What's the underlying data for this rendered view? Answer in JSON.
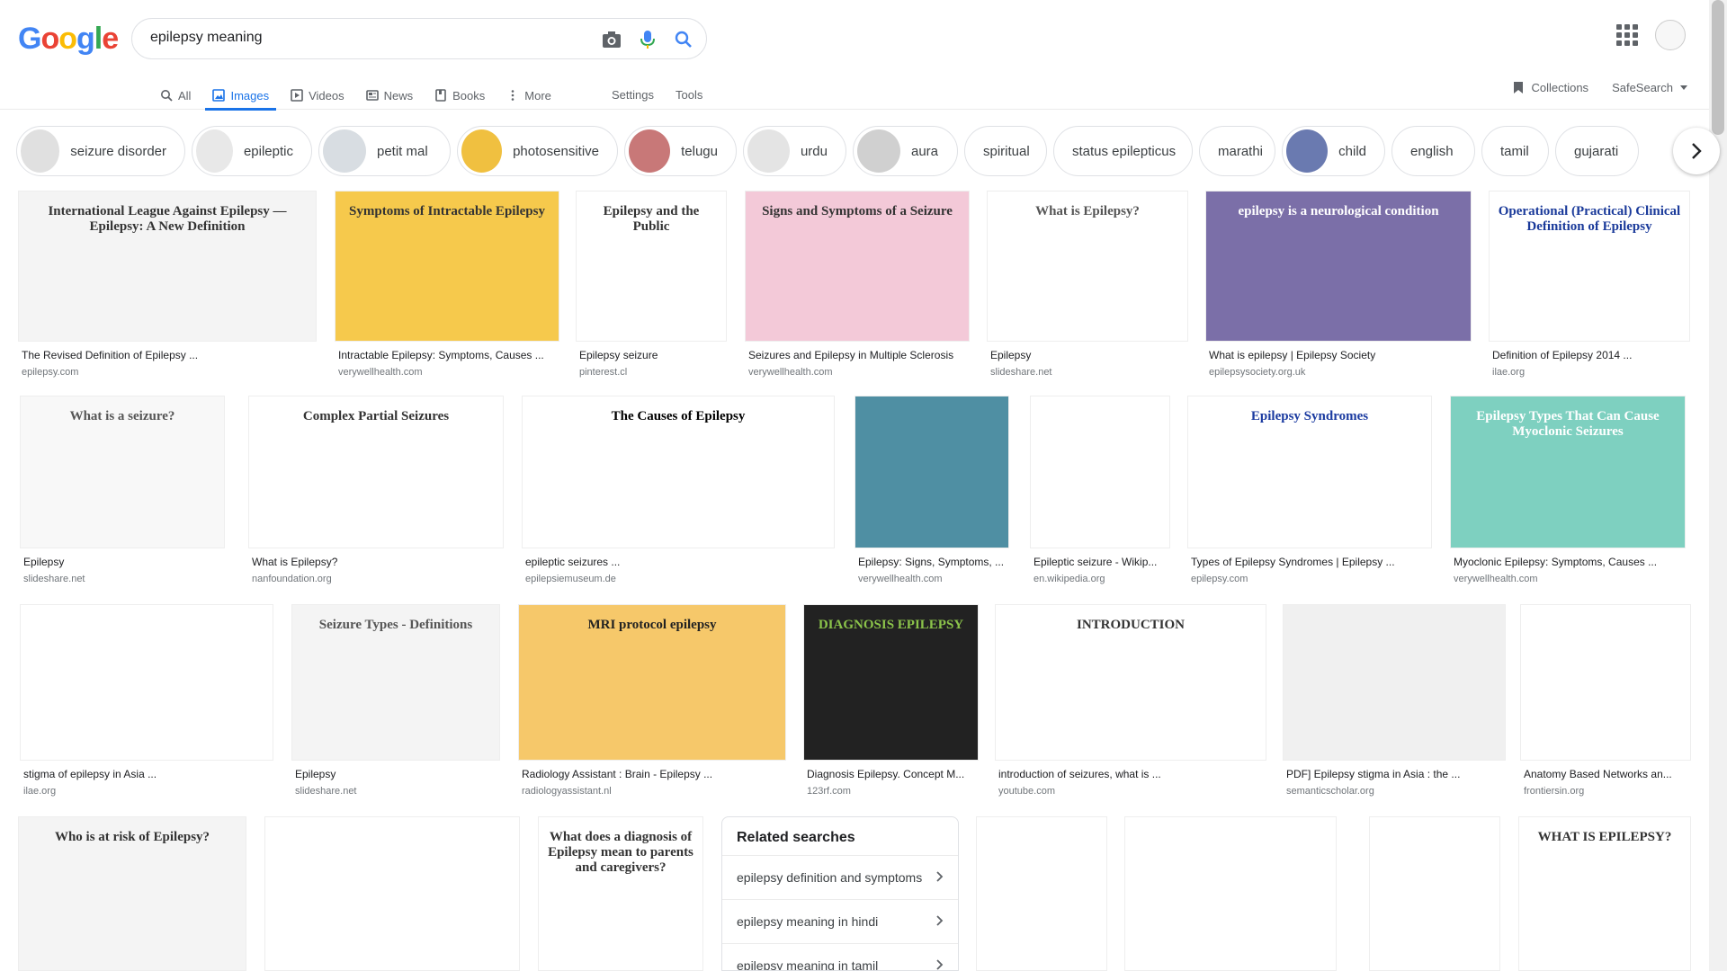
{
  "logo": [
    "G",
    "o",
    "o",
    "g",
    "l",
    "e"
  ],
  "logo_colors": [
    "#4285F4",
    "#EA4335",
    "#FBBC05",
    "#4285F4",
    "#34A853",
    "#EA4335"
  ],
  "search": {
    "query": "epilepsy meaning"
  },
  "tabs": [
    {
      "label": "All",
      "icon": "search-icon",
      "active": false
    },
    {
      "label": "Images",
      "icon": "image-icon",
      "active": true
    },
    {
      "label": "Videos",
      "icon": "video-icon",
      "active": false
    },
    {
      "label": "News",
      "icon": "news-icon",
      "active": false
    },
    {
      "label": "Books",
      "icon": "book-icon",
      "active": false
    },
    {
      "label": "More",
      "icon": "more-vert-icon",
      "active": false
    }
  ],
  "settings_tabs": [
    "Settings",
    "Tools"
  ],
  "right_tools": {
    "collections": "Collections",
    "safesearch": "SafeSearch"
  },
  "accent": "#1a73e8",
  "chips": [
    {
      "label": "seizure disorder",
      "thumb": true
    },
    {
      "label": "epileptic",
      "thumb": true
    },
    {
      "label": "petit mal",
      "thumb": true
    },
    {
      "label": "photosensitive",
      "thumb": true
    },
    {
      "label": "telugu",
      "thumb": true
    },
    {
      "label": "urdu",
      "thumb": true
    },
    {
      "label": "aura",
      "thumb": true
    },
    {
      "label": "spiritual",
      "thumb": false
    },
    {
      "label": "status epilepticus",
      "thumb": false
    },
    {
      "label": "marathi",
      "thumb": false
    },
    {
      "label": "child",
      "thumb": true
    },
    {
      "label": "english",
      "thumb": false
    },
    {
      "label": "tamil",
      "thumb": false
    },
    {
      "label": "gujarati",
      "thumb": false
    }
  ],
  "results": [
    {
      "title": "The Revised Definition of Epilepsy ...",
      "source": "epilepsy.com",
      "img_text": "International League Against Epilepsy — Epilepsy: A New Definition"
    },
    {
      "title": "Intractable Epilepsy: Symptoms, Causes ...",
      "source": "verywellhealth.com",
      "img_text": "Symptoms of Intractable Epilepsy"
    },
    {
      "title": "Epilepsy seizure",
      "source": "pinterest.cl",
      "img_text": "Epilepsy and the Public"
    },
    {
      "title": "Seizures and Epilepsy in Multiple Sclerosis",
      "source": "verywellhealth.com",
      "img_text": "Signs and Symptoms of a Seizure"
    },
    {
      "title": "Epilepsy",
      "source": "slideshare.net",
      "img_text": "What is Epilepsy?"
    },
    {
      "title": "What is epilepsy | Epilepsy Society",
      "source": "epilepsysociety.org.uk",
      "img_text": "epilepsy is a neurological condition"
    },
    {
      "title": "Definition of Epilepsy 2014 ...",
      "source": "ilae.org",
      "img_text": "Operational (Practical) Clinical Definition of Epilepsy"
    },
    {
      "title": "Epilepsy",
      "source": "slideshare.net",
      "img_text": "What is a seizure?"
    },
    {
      "title": "What is Epilepsy?",
      "source": "nanfoundation.org",
      "img_text": "Complex Partial Seizures"
    },
    {
      "title": "epileptic seizures ...",
      "source": "epilepsiemuseum.de",
      "img_text": "The Causes of Epilepsy"
    },
    {
      "title": "Epilepsy: Signs, Symptoms, ...",
      "source": "verywellhealth.com",
      "img_text": ""
    },
    {
      "title": "Epileptic seizure - Wikip...",
      "source": "en.wikipedia.org",
      "img_text": ""
    },
    {
      "title": "Types of Epilepsy Syndromes | Epilepsy ...",
      "source": "epilepsy.com",
      "img_text": "Epilepsy Syndromes"
    },
    {
      "title": "Myoclonic Epilepsy: Symptoms, Causes ...",
      "source": "verywellhealth.com",
      "img_text": "Epilepsy Types That Can Cause Myoclonic Seizures"
    },
    {
      "title": "stigma of epilepsy in Asia ...",
      "source": "ilae.org",
      "img_text": ""
    },
    {
      "title": "Epilepsy",
      "source": "slideshare.net",
      "img_text": "Seizure Types - Definitions"
    },
    {
      "title": "Radiology Assistant : Brain - Epilepsy ...",
      "source": "radiologyassistant.nl",
      "img_text": "MRI protocol epilepsy"
    },
    {
      "title": "Diagnosis Epilepsy. Concept M...",
      "source": "123rf.com",
      "img_text": "DIAGNOSIS EPILEPSY"
    },
    {
      "title": "introduction of seizures, what is ...",
      "source": "youtube.com",
      "img_text": "INTRODUCTION"
    },
    {
      "title": "PDF] Epilepsy stigma in Asia : the ...",
      "source": "semanticscholar.org",
      "img_text": ""
    },
    {
      "title": "Anatomy Based Networks an...",
      "source": "frontiersin.org",
      "img_text": ""
    },
    {
      "title": "",
      "source": "",
      "img_text": "Who is at risk of Epilepsy?"
    },
    {
      "title": "",
      "source": "",
      "img_text": ""
    },
    {
      "title": "",
      "source": "",
      "img_text": "What does a diagnosis of Epilepsy mean to parents and caregivers?"
    },
    {
      "title": "",
      "source": "",
      "img_text": ""
    },
    {
      "title": "",
      "source": "",
      "img_text": ""
    },
    {
      "title": "",
      "source": "",
      "img_text": ""
    },
    {
      "title": "",
      "source": "",
      "img_text": "WHAT IS EPILEPSY?"
    }
  ],
  "related": {
    "heading": "Related searches",
    "items": [
      "epilepsy definition and symptoms",
      "epilepsy meaning in hindi",
      "epilepsy meaning in tamil"
    ]
  }
}
